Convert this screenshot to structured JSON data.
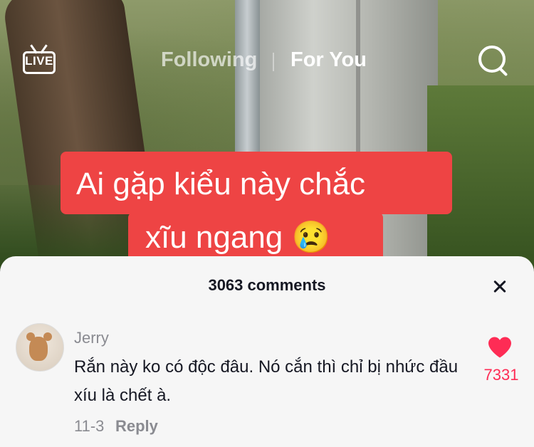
{
  "header": {
    "live_label": "LIVE",
    "tabs": [
      {
        "label": "Following",
        "active": false
      },
      {
        "label": "For You",
        "active": true
      }
    ]
  },
  "video": {
    "caption_line1": "Ai gặp kiểu này chắc",
    "caption_line2": "xĩu ngang 😢"
  },
  "comments_panel": {
    "count_text": "3063 comments",
    "comment": {
      "username": "Jerry",
      "text": "Rắn này ko có độc đâu. Nó cắn thì chỉ bị nhức đầu xíu là chết à.",
      "date": "11-3",
      "reply_label": "Reply",
      "like_count": "7331"
    }
  },
  "colors": {
    "accent": "#fe2c55",
    "caption_bg": "#ee4444"
  }
}
